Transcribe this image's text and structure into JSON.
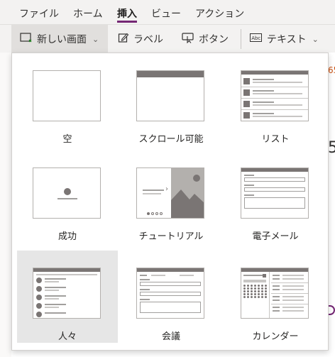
{
  "menubar": {
    "items": [
      {
        "label": "ファイル"
      },
      {
        "label": "ホーム"
      },
      {
        "label": "挿入"
      },
      {
        "label": "ビュー"
      },
      {
        "label": "アクション"
      }
    ],
    "active": "挿入"
  },
  "toolbar": {
    "new_screen_label": "新しい画面",
    "label_label": "ラベル",
    "button_label": "ボタン",
    "text_label": "テキスト"
  },
  "background": {
    "right_digits": "65",
    "right_large": "5"
  },
  "screen_templates": [
    {
      "label": "空",
      "icon": "blank-template-icon"
    },
    {
      "label": "スクロール可能",
      "icon": "scrollable-template-icon"
    },
    {
      "label": "リスト",
      "icon": "list-template-icon"
    },
    {
      "label": "成功",
      "icon": "success-template-icon"
    },
    {
      "label": "チュートリアル",
      "icon": "tutorial-template-icon"
    },
    {
      "label": "電子メール",
      "icon": "email-template-icon"
    },
    {
      "label": "人々",
      "icon": "people-template-icon",
      "selected": true
    },
    {
      "label": "会議",
      "icon": "meeting-template-icon"
    },
    {
      "label": "カレンダー",
      "icon": "calendar-template-icon"
    }
  ],
  "colors": {
    "accent": "#742774",
    "tile_selected": "#e6e6e6",
    "thumb_dark": "#7a7574"
  }
}
